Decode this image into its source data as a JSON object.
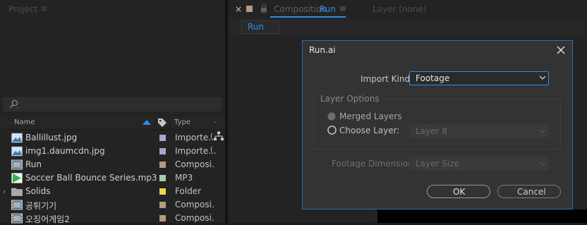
{
  "project_panel": {
    "title": "Project",
    "menu_glyph": "≡",
    "columns": {
      "name": "Name",
      "type": "Type",
      "extra": "."
    },
    "items": [
      {
        "name": "Ballillust.jpg",
        "type": "Importe...",
        "extra": "(",
        "icon": "image-file-icon",
        "label_color": "#a5a5cf"
      },
      {
        "name": "img1.daumcdn.jpg",
        "type": "Importe...",
        "extra": "(",
        "icon": "image-file-icon",
        "label_color": "#a5a5cf"
      },
      {
        "name": "Run",
        "type": "Composi.",
        "extra": "",
        "icon": "composition-icon",
        "label_color": "#b49b7d"
      },
      {
        "name": "Soccer Ball Bounce Series.mp3",
        "type": "MP3",
        "extra": "",
        "icon": "audio-file-icon",
        "label_color": "#a6cfa6"
      },
      {
        "name": "Solids",
        "type": "Folder",
        "extra": "",
        "icon": "folder-icon",
        "label_color": "#e6d94a",
        "expandable": "›"
      },
      {
        "name": "공튀기기",
        "type": "Composi.",
        "extra": "",
        "icon": "composition-icon",
        "label_color": "#b49b7d"
      },
      {
        "name": "오징어게임2",
        "type": "Composi.",
        "extra": "",
        "icon": "composition-icon",
        "label_color": "#b49b7d"
      }
    ]
  },
  "composition_panel": {
    "close_glyph": "×",
    "tab_prefix": "Composition",
    "tab_name": "Run",
    "menu_glyph": "≡",
    "layer_tab": "Layer (none)",
    "subtab": "Run",
    "accent": "#2d8ceb"
  },
  "dialog": {
    "title": "Run.ai",
    "import_kind_label": "Import Kind:",
    "import_kind_value": "Footage",
    "layer_options_label": "Layer Options",
    "merged_layers_label": "Merged Layers",
    "choose_layer_label": "Choose Layer:",
    "choose_layer_value": "Layer 8",
    "footage_dimensions_label": "Footage Dimensions:",
    "footage_dimensions_value": "Layer Size",
    "ok_label": "OK",
    "cancel_label": "Cancel"
  }
}
